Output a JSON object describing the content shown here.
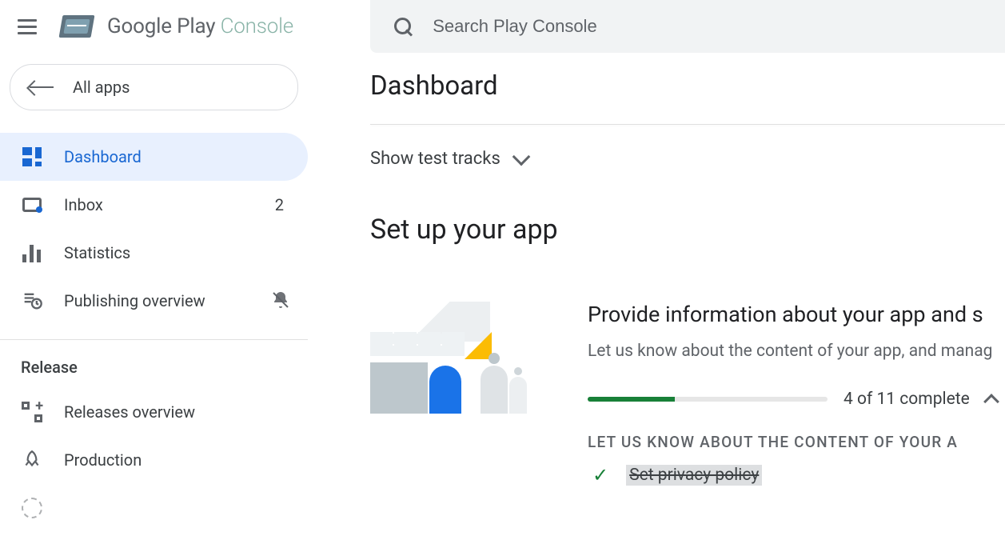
{
  "brand": {
    "primary": "Google Play",
    "secondary": "Console"
  },
  "search": {
    "placeholder": "Search Play Console"
  },
  "all_apps_label": "All apps",
  "nav": {
    "dashboard": "Dashboard",
    "inbox": "Inbox",
    "inbox_badge": "2",
    "statistics": "Statistics",
    "publishing_overview": "Publishing overview"
  },
  "release_section": {
    "label": "Release",
    "releases_overview": "Releases overview",
    "production": "Production"
  },
  "page": {
    "title": "Dashboard",
    "show_tracks": "Show test tracks",
    "setup_heading": "Set up your app"
  },
  "card": {
    "title": "Provide information about your app and s",
    "sub": "Let us know about the content of your app, and manag",
    "progress_done": 4,
    "progress_total": 11,
    "progress_label": "4 of 11 complete",
    "subhead": "LET US KNOW ABOUT THE CONTENT OF YOUR A",
    "task1": "Set privacy policy"
  },
  "colors": {
    "accent": "#1967d2",
    "success": "#188038"
  }
}
